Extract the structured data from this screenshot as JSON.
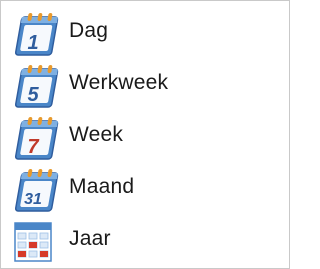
{
  "menu": {
    "items": [
      {
        "label": "Dag",
        "icon": "calendar-day-icon",
        "number": "1",
        "number_color": "#2f5d9e"
      },
      {
        "label": "Werkweek",
        "icon": "calendar-workweek-icon",
        "number": "5",
        "number_color": "#2f5d9e"
      },
      {
        "label": "Week",
        "icon": "calendar-week-icon",
        "number": "7",
        "number_color": "#c0392b"
      },
      {
        "label": "Maand",
        "icon": "calendar-month-icon",
        "number": "31",
        "number_color": "#2f5d9e"
      },
      {
        "label": "Jaar",
        "icon": "calendar-year-grid-icon"
      }
    ]
  },
  "colors": {
    "calendar_blue": "#4a86c8",
    "calendar_light": "#dce9f7",
    "ring_orange": "#e89a2c",
    "grid_red": "#d63a2a"
  }
}
